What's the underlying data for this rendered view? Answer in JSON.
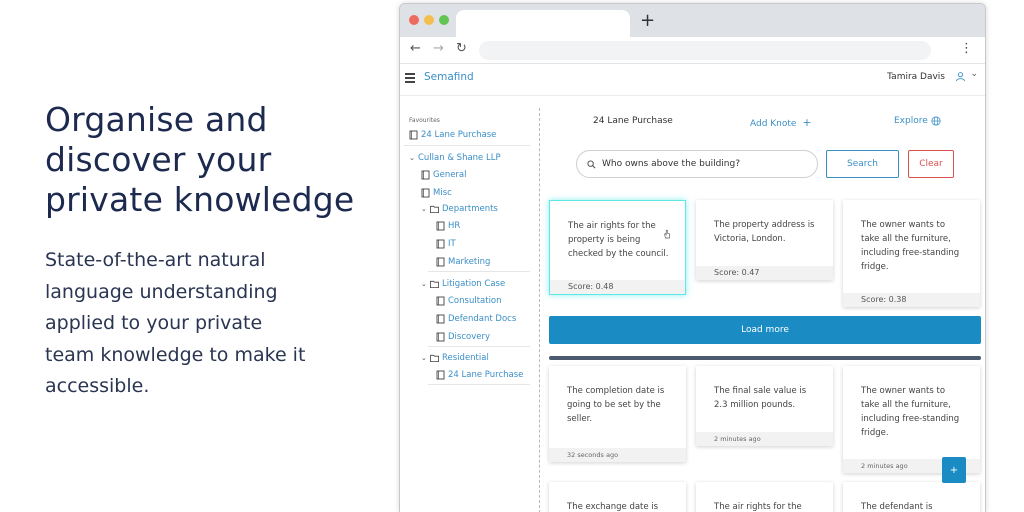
{
  "hero": {
    "heading_lines": [
      "Organise and",
      "discover your",
      "private knowledge"
    ],
    "body_lines": [
      "State-of-the-art natural",
      "language understanding",
      "applied to your private",
      "team knowledge to make it",
      "accessible."
    ]
  },
  "browser": {
    "new_tab_label": "+",
    "back_icon": "←",
    "forward_icon": "→",
    "reload_icon": "↻",
    "menu_icon": "⋮"
  },
  "appbar": {
    "brand": "Semafind",
    "user_name": "Tamira Davis",
    "chevron": "⌄"
  },
  "sidebar": {
    "heading": "Favourites",
    "favourite": "24 Lane Purchase",
    "workspace": "Cullan & Shane LLP",
    "general": "General",
    "misc": "Misc",
    "departments": "Departments",
    "hr": "HR",
    "it": "IT",
    "marketing": "Marketing",
    "litigation": "Litigation Case",
    "consultation": "Consultation",
    "defendant_docs": "Defendant Docs",
    "discovery": "Discovery",
    "residential": "Residential",
    "residential_item": "24 Lane Purchase"
  },
  "main": {
    "title": "24 Lane Purchase",
    "add_knote": "Add Knote",
    "add_icon": "+",
    "explore": "Explore",
    "search_value": "Who owns above the building?",
    "search_button": "Search",
    "clear_button": "Clear",
    "load_more": "Load more",
    "fab_label": "+"
  },
  "results": [
    {
      "text": "The air rights for the property is being checked by the council.",
      "footer": "Score: 0.48"
    },
    {
      "text": "The property address is Victoria, London.",
      "footer": "Score: 0.47"
    },
    {
      "text": "The owner wants to take all the furniture, including free-standing fridge.",
      "footer": "Score: 0.38"
    }
  ],
  "recent": [
    {
      "text": "The completion date is going to be set by the seller.",
      "footer": "32 seconds ago"
    },
    {
      "text": "The final sale value is 2.3 million pounds.",
      "footer": "2 minutes ago"
    },
    {
      "text": "The owner wants to take all the furniture, including free-standing fridge.",
      "footer": "2 minutes ago"
    }
  ],
  "partial": [
    {
      "text": "The exchange date is"
    },
    {
      "text": "The air rights for the"
    },
    {
      "text": "The defendant is"
    }
  ],
  "colors": {
    "accent": "#1b8cc3",
    "link": "#3a8fc7",
    "danger": "#d9534f",
    "selected": "#5ee6e8"
  }
}
